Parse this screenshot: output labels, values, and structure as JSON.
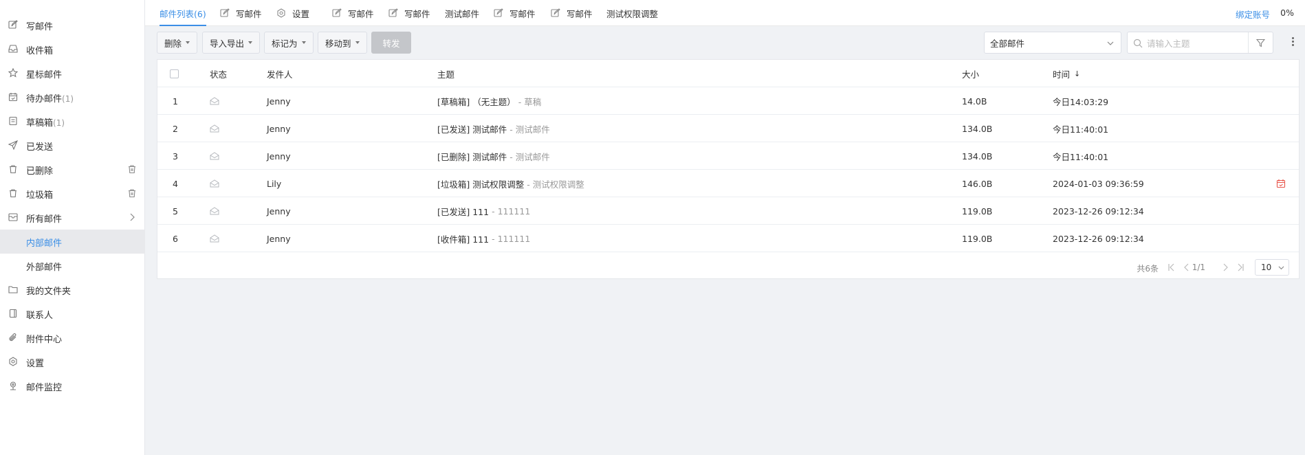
{
  "sidebar": {
    "items": [
      {
        "label": "写邮件",
        "count": ""
      },
      {
        "label": "收件箱",
        "count": ""
      },
      {
        "label": "星标邮件",
        "count": ""
      },
      {
        "label": "待办邮件",
        "count": "(1)"
      },
      {
        "label": "草稿箱",
        "count": "(1)"
      },
      {
        "label": "已发送",
        "count": ""
      },
      {
        "label": "已删除",
        "count": ""
      },
      {
        "label": "垃圾箱",
        "count": ""
      },
      {
        "label": "所有邮件",
        "count": ""
      },
      {
        "label": "内部邮件",
        "count": ""
      },
      {
        "label": "外部邮件",
        "count": ""
      },
      {
        "label": "我的文件夹",
        "count": ""
      },
      {
        "label": "联系人",
        "count": ""
      },
      {
        "label": "附件中心",
        "count": ""
      },
      {
        "label": "设置",
        "count": ""
      },
      {
        "label": "邮件监控",
        "count": ""
      }
    ]
  },
  "tabs": [
    {
      "label": "邮件列表(6)"
    },
    {
      "label": "写邮件"
    },
    {
      "label": "设置"
    },
    {
      "label": "写邮件"
    },
    {
      "label": "写邮件"
    },
    {
      "label": "测试邮件"
    },
    {
      "label": "写邮件"
    },
    {
      "label": "写邮件"
    },
    {
      "label": "测试权限调整"
    }
  ],
  "header": {
    "bind_account": "绑定账号",
    "percent": "0%"
  },
  "toolbar": {
    "delete": "删除",
    "import_export": "导入导出",
    "mark_as": "标记为",
    "move_to": "移动到",
    "forward": "转发",
    "filter_value": "全部邮件",
    "search_placeholder": "请输入主题"
  },
  "table": {
    "columns": {
      "status": "状态",
      "sender": "发件人",
      "subject": "主题",
      "size": "大小",
      "time": "时间",
      "sort_arrow": "↓"
    },
    "rows": [
      {
        "index": "1",
        "sender": "Jenny",
        "subject": "[草稿箱] （无主题）",
        "preview": "- 草稿",
        "size": "14.0B",
        "time": "今日14:03:29"
      },
      {
        "index": "2",
        "sender": "Jenny",
        "subject": "[已发送] 测试邮件",
        "preview": "- 测试邮件",
        "size": "134.0B",
        "time": "今日11:40:01"
      },
      {
        "index": "3",
        "sender": "Jenny",
        "subject": "[已删除] 测试邮件",
        "preview": "- 测试邮件",
        "size": "134.0B",
        "time": "今日11:40:01"
      },
      {
        "index": "4",
        "sender": "Lily",
        "subject": "[垃圾箱] 测试权限调整",
        "preview": "- 测试权限调整",
        "size": "146.0B",
        "time": "2024-01-03 09:36:59"
      },
      {
        "index": "5",
        "sender": "Jenny",
        "subject": "[已发送] 111",
        "preview": "- 111111",
        "size": "119.0B",
        "time": "2023-12-26 09:12:34"
      },
      {
        "index": "6",
        "sender": "Jenny",
        "subject": "[收件箱] 111",
        "preview": "- 111111",
        "size": "119.0B",
        "time": "2023-12-26 09:12:34"
      }
    ]
  },
  "pagination": {
    "total": "共6条",
    "page": "1/1",
    "page_size": "10"
  },
  "colors": {
    "accent": "#3a8ee6",
    "danger": "#e8554b"
  }
}
